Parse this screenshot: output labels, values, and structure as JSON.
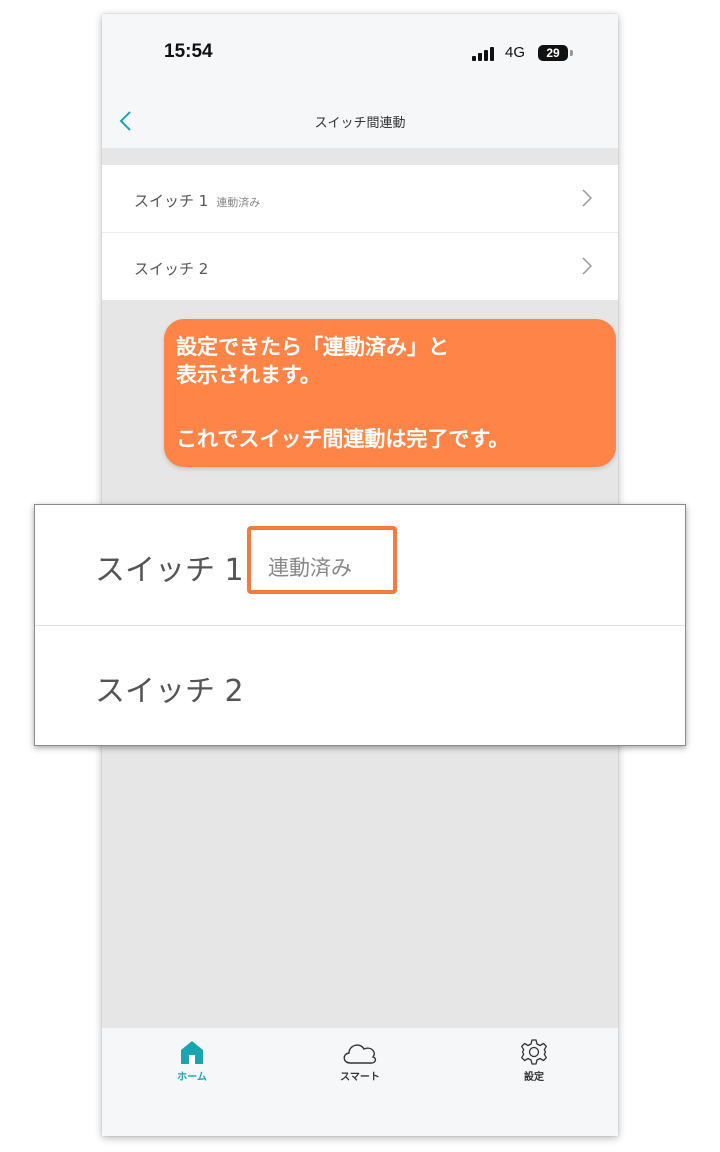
{
  "status_bar": {
    "time": "15:54",
    "network": "4G",
    "battery": "29"
  },
  "nav": {
    "title": "スイッチ間連動"
  },
  "list": {
    "items": [
      {
        "label": "スイッチ 1",
        "badge": "連動済み"
      },
      {
        "label": "スイッチ 2",
        "badge": ""
      }
    ]
  },
  "callout": {
    "lines": [
      "設定できたら「連動済み」と",
      "表示されます。",
      "これでスイッチ間連動は完了です。"
    ]
  },
  "zoom": {
    "items": [
      {
        "label": "スイッチ 1",
        "badge": "連動済み"
      },
      {
        "label": "スイッチ 2"
      }
    ]
  },
  "tabs": [
    {
      "label": "ホーム",
      "icon": "home-icon",
      "active": true
    },
    {
      "label": "スマート",
      "icon": "cloud-icon",
      "active": false
    },
    {
      "label": "設定",
      "icon": "gear-icon",
      "active": false
    }
  ],
  "colors": {
    "accent": "#1aa5b0",
    "callout": "#ff8447",
    "highlight": "#f47a3e"
  }
}
